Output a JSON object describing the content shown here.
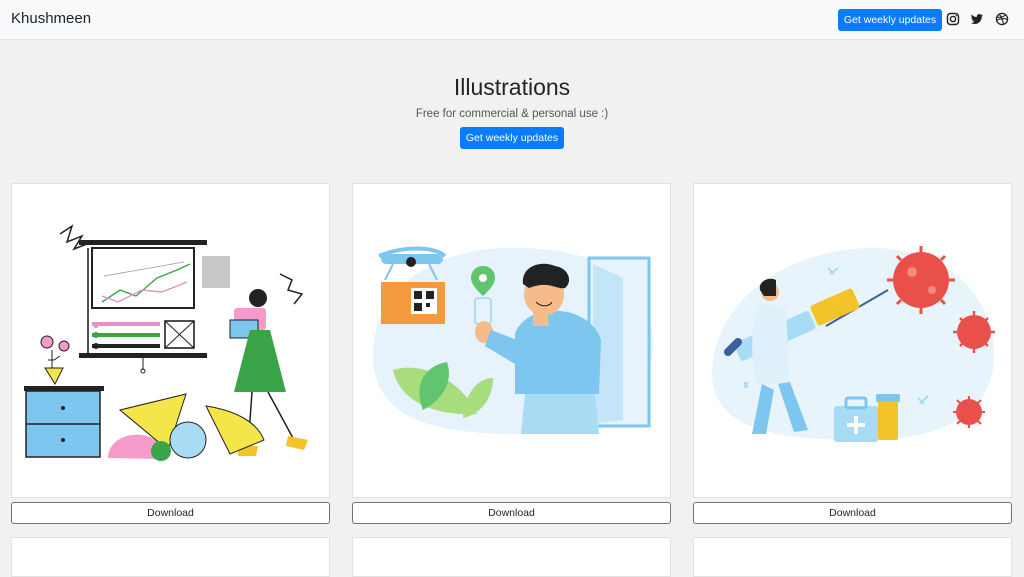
{
  "navbar": {
    "brand": "Khushmeen",
    "cta_label": "Get weekly updates",
    "social": [
      "instagram-icon",
      "twitter-icon",
      "dribbble-icon"
    ]
  },
  "hero": {
    "title": "Illustrations",
    "subtitle": "Free for commercial & personal use :)",
    "cta_label": "Get weekly updates"
  },
  "cards": [
    {
      "illustration": "presentation-illustration",
      "download_label": "Download"
    },
    {
      "illustration": "delivery-illustration",
      "download_label": "Download"
    },
    {
      "illustration": "vaccine-illustration",
      "download_label": "Download"
    }
  ],
  "colors": {
    "primary": "#0a7cff",
    "background": "#f1f1f1",
    "navbar": "#f8f9fa"
  }
}
